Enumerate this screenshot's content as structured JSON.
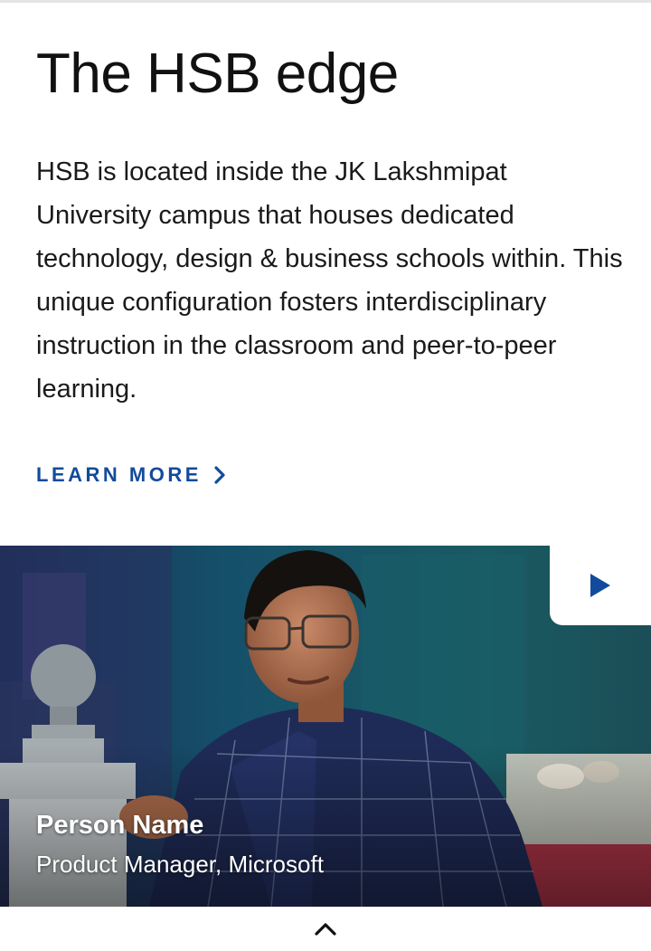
{
  "section": {
    "title": "The HSB edge",
    "description": "HSB is located inside the JK Lakshmipat University campus that houses dedicated technology, design & business schools within. This unique configuration fosters interdisciplinary instruction in the classroom and peer-to-peer learning.",
    "cta_label": "LEARN MORE",
    "cta_icon": "chevron-right-icon"
  },
  "video_card": {
    "person_name": "Person Name",
    "person_role": "Product Manager, Microsoft",
    "play_icon": "play-icon"
  },
  "footer": {
    "scroll_icon": "chevron-up-icon"
  },
  "colors": {
    "accent": "#124b9c",
    "title_text": "#111111",
    "body_text": "#1a1a1a",
    "video_background": "#1d4a52"
  }
}
